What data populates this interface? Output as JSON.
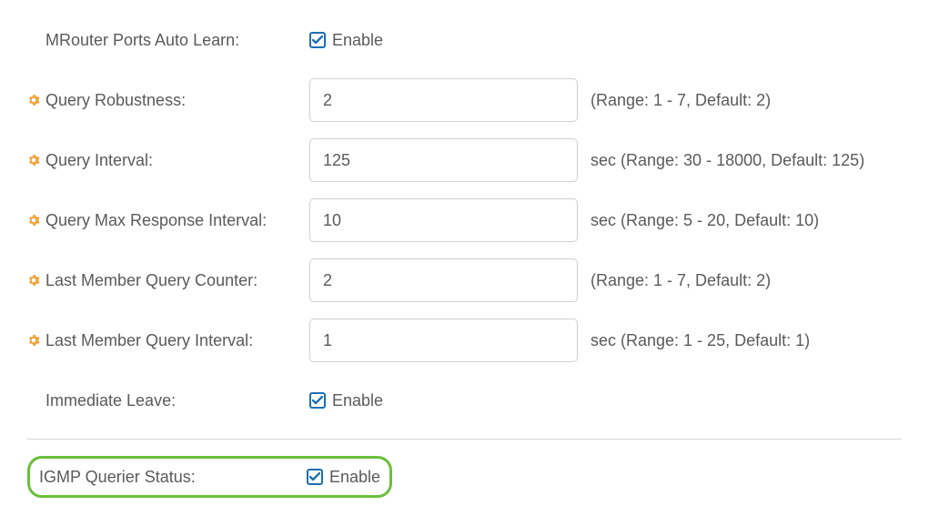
{
  "rows": {
    "mrouter": {
      "label": "MRouter Ports Auto Learn:",
      "checkbox_label": "Enable"
    },
    "robustness": {
      "label": "Query Robustness:",
      "value": "2",
      "hint": "(Range: 1 - 7, Default: 2)"
    },
    "interval": {
      "label": "Query Interval:",
      "value": "125",
      "hint": "sec (Range: 30 - 18000, Default: 125)"
    },
    "max_response": {
      "label": "Query Max Response Interval:",
      "value": "10",
      "hint": "sec (Range: 5 - 20, Default: 10)"
    },
    "last_counter": {
      "label": "Last Member Query Counter:",
      "value": "2",
      "hint": "(Range: 1 - 7, Default: 2)"
    },
    "last_interval": {
      "label": "Last Member Query Interval:",
      "value": "1",
      "hint": "sec (Range: 1 - 25, Default: 1)"
    },
    "immediate": {
      "label": "Immediate Leave:",
      "checkbox_label": "Enable"
    },
    "querier": {
      "label": "IGMP Querier Status:",
      "checkbox_label": "Enable"
    }
  },
  "colors": {
    "accent": "#1a6fb3",
    "gear": "#f2a13a",
    "highlight": "#6abf3a"
  }
}
